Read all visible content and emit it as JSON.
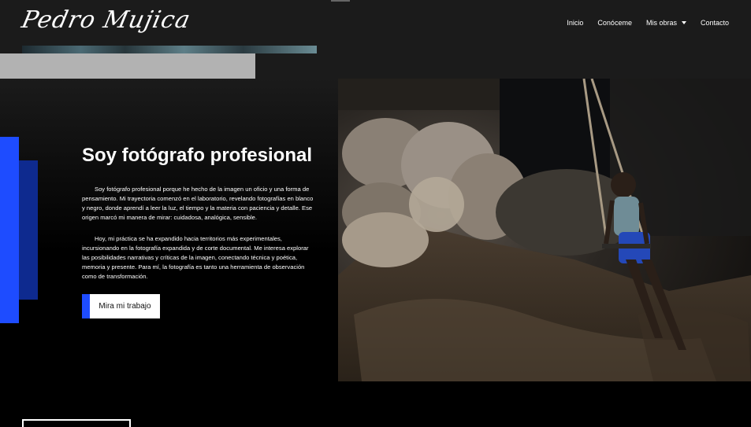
{
  "header": {
    "logo": "Pedro Mujica",
    "nav": [
      {
        "label": "Inicio"
      },
      {
        "label": "Conóceme"
      },
      {
        "label": "Mis obras",
        "has_dropdown": true
      },
      {
        "label": "Contacto"
      }
    ]
  },
  "hero": {
    "title": "Soy fotógrafo profesional",
    "paragraphs": [
      "Soy fotógrafo profesional porque he hecho de la imagen un oficio y una forma de pensamiento. Mi trayectoria comenzó en el laboratorio, revelando fotografías en blanco y negro, donde aprendí a leer la luz, el tiempo y la materia con paciencia y detalle. Ese origen marcó mi manera de mirar: cuidadosa, analógica, sensible.",
      "Hoy, mi práctica se ha expandido hacia territorios más experimentales, incursionando en la fotografía expandida y de corte documental. Me interesa explorar las posibilidades narrativas y críticas de la imagen, conectando técnica y poética, memoria y presente. Para mí, la fotografía es tanto una herramienta de observación como de transformación."
    ],
    "cta_label": "Mira mi trabajo"
  },
  "colors": {
    "accent": "#1e4cff",
    "accent_dark": "#0e2a8f",
    "background": "#000000",
    "header_bg": "#1b1b1b"
  },
  "icons": {
    "dropdown": "caret-down-icon"
  }
}
